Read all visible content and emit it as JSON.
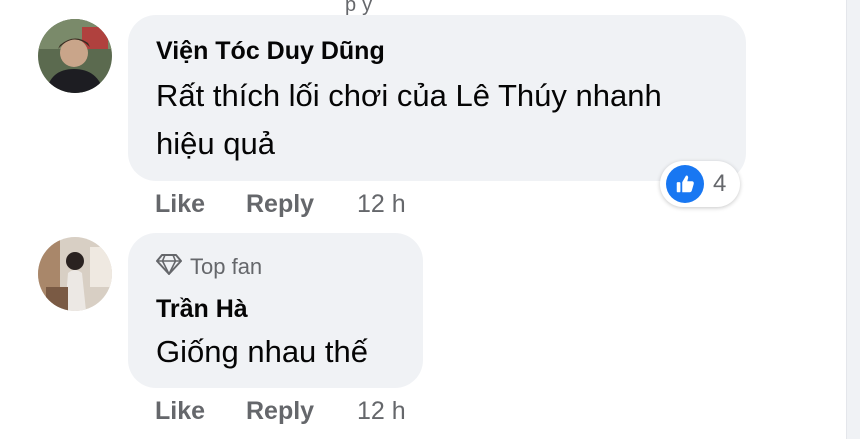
{
  "top_fragment": "py",
  "comments": [
    {
      "author": "Viện Tóc Duy Dũng",
      "text_lines": [
        "Rất thích lối chơi của Lê Thúy nhanh",
        "hiệu quả"
      ],
      "like_label": "Like",
      "reply_label": "Reply",
      "time": "12 h",
      "reaction": {
        "icon": "thumbs-up-icon",
        "count": "4",
        "color": "#1877f2"
      }
    },
    {
      "badge": {
        "icon": "diamond-icon",
        "label": "Top fan"
      },
      "author": "Trần Hà",
      "text_lines": [
        "Giống nhau thế"
      ],
      "like_label": "Like",
      "reply_label": "Reply",
      "time": "12 h"
    }
  ],
  "colors": {
    "bubble": "#f0f2f5",
    "text": "#050505",
    "secondary": "#65676b",
    "accent": "#1877f2"
  }
}
